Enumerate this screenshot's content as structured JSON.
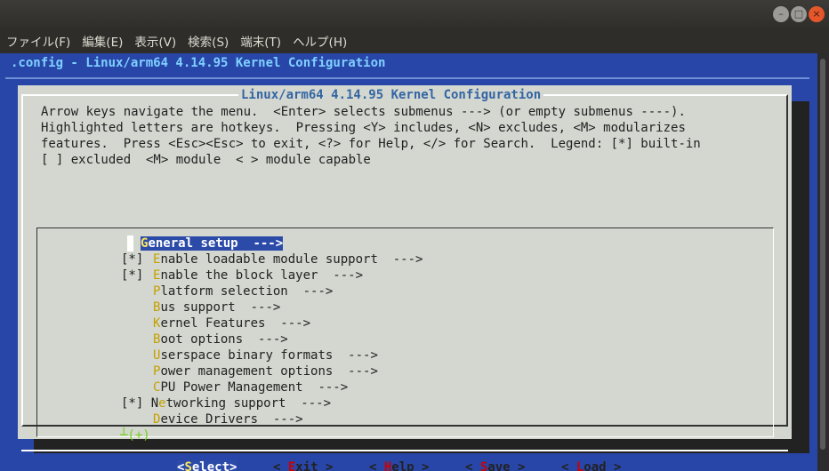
{
  "window": {
    "menu": [
      "ファイル(F)",
      "編集(E)",
      "表示(V)",
      "検索(S)",
      "端末(T)",
      "ヘルプ(H)"
    ],
    "buttons": {
      "minimize": "–",
      "maximize": "□",
      "close": "×"
    }
  },
  "terminal": {
    "title": ".config - Linux/arm64 4.14.95 Kernel Configuration"
  },
  "dialog": {
    "title": "Linux/arm64 4.14.95 Kernel Configuration",
    "help": [
      "Arrow keys navigate the menu.  <Enter> selects submenus ---> (or empty submenus ----).",
      "Highlighted letters are hotkeys.  Pressing <Y> includes, <N> excludes, <M> modularizes",
      "features.  Press <Esc><Esc> to exit, <?> for Help, </> for Search.  Legend: [*] built-in",
      "[ ] excluded  <M> module  < > module capable"
    ],
    "items": [
      {
        "mark": "",
        "hotkey": "G",
        "rest": "eneral setup  --->"
      },
      {
        "mark": "[*]",
        "hotkey": "E",
        "rest": "nable loadable module support  --->"
      },
      {
        "mark": "[*]",
        "hotkey": "E",
        "rest": "nable the block layer  --->"
      },
      {
        "mark": "",
        "hotkey": "P",
        "rest": "latform selection  --->"
      },
      {
        "mark": "",
        "hotkey": "B",
        "rest": "us support  --->"
      },
      {
        "mark": "",
        "hotkey": "K",
        "rest": "ernel Features  --->"
      },
      {
        "mark": "",
        "hotkey": "B",
        "rest": "oot options  --->"
      },
      {
        "mark": "",
        "hotkey": "U",
        "rest": "serspace binary formats  --->"
      },
      {
        "mark": "",
        "hotkey": "P",
        "rest": "ower management options  --->"
      },
      {
        "mark": "",
        "hotkey": "C",
        "rest": "PU Power Management  --->"
      },
      {
        "mark": "[*] N",
        "hotkey": "e",
        "rest": "tworking support  --->"
      },
      {
        "mark": "",
        "hotkey": "D",
        "rest": "evice Drivers  --->"
      }
    ],
    "more_indicator": "┴(+)",
    "buttons": [
      {
        "pre": "<",
        "hotkey": "S",
        "rest": "elect>"
      },
      {
        "pre": "< ",
        "hotkey": "E",
        "rest": "xit >"
      },
      {
        "pre": "< ",
        "hotkey": "H",
        "rest": "elp >"
      },
      {
        "pre": "< ",
        "hotkey": "S",
        "rest": "ave >"
      },
      {
        "pre": "< ",
        "hotkey": "L",
        "rest": "oad >"
      }
    ]
  }
}
